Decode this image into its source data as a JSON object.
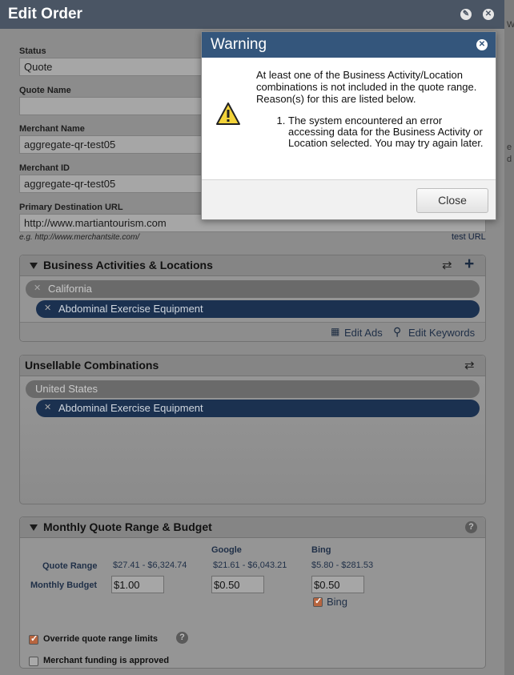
{
  "window": {
    "title": "Edit Order"
  },
  "form": {
    "status": {
      "label": "Status",
      "value": "Quote"
    },
    "quote_name": {
      "label": "Quote Name",
      "value": ""
    },
    "merchant_name": {
      "label": "Merchant Name",
      "value": "aggregate-qr-test05"
    },
    "merchant_id": {
      "label": "Merchant ID",
      "value": "aggregate-qr-test05"
    },
    "primary_url": {
      "label": "Primary Destination URL",
      "value": "http://www.martiantourism.com",
      "hint": "e.g. http://www.merchantsite.com/",
      "test_link": "test URL"
    }
  },
  "business_panel": {
    "title": "Business Activities & Locations",
    "location": "California",
    "activity": "Abdominal Exercise Equipment",
    "edit_ads": "Edit Ads",
    "edit_keywords": "Edit Keywords"
  },
  "unsellable_panel": {
    "title": "Unsellable Combinations",
    "location": "United States",
    "activity": "Abdominal Exercise Equipment"
  },
  "budget_panel": {
    "title": "Monthly Quote Range & Budget",
    "col_google": "Google",
    "col_bing": "Bing",
    "row_quote_range": "Quote Range",
    "row_monthly_budget": "Monthly Budget",
    "quote_total": "$27.41 - $6,324.74",
    "quote_google": "$21.61 - $6,043.21",
    "quote_bing": "$5.80 - $281.53",
    "budget_total": "$1.00",
    "budget_google": "$0.50",
    "budget_bing": "$0.50",
    "bing_checkbox_label": "Bing",
    "bing_checked": true,
    "override_label": "Override quote range limits",
    "override_checked": true,
    "funding_label": "Merchant funding is approved",
    "funding_checked": false
  },
  "dialog": {
    "title": "Warning",
    "message": "At least one of the Business Activity/Location combinations is not included in the quote range. Reason(s) for this are listed below.",
    "reasons": [
      "The system encountered an error accessing data for the Business Activity or Location selected. You may try again later."
    ],
    "close_button": "Close"
  },
  "right_edge": {
    "c1": "W",
    "c2": "e",
    "c3": "d"
  },
  "colors": {
    "header": "#4a5564",
    "dialog_header": "#34567c",
    "pill_blue": "#1b3150",
    "checkbox": "#b7653f"
  },
  "icons": [
    "comment-icon",
    "close-icon",
    "refresh-icon",
    "plus-icon",
    "grid-icon",
    "search-icon",
    "help-icon",
    "warning-icon",
    "caret-down-icon",
    "checkbox-icon"
  ]
}
